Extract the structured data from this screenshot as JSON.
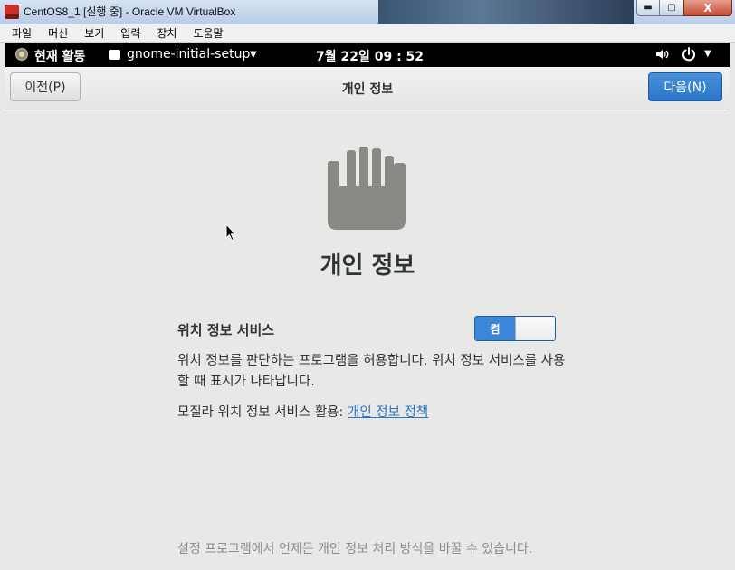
{
  "window": {
    "title": "CentOS8_1 [실행 중] - Oracle VM VirtualBox",
    "close_glyph": "X",
    "minimize_glyph": "▬",
    "maximize_glyph": "▢"
  },
  "vb_menu": [
    "파일",
    "머신",
    "보기",
    "입력",
    "장치",
    "도움말"
  ],
  "gnome_bar": {
    "activities": "현재 활동",
    "app_name": "gnome-initial-setup",
    "clock": "7월 22일  09 : 52",
    "dropdown_arrow": "▼"
  },
  "header": {
    "prev_label": "이전(P)",
    "title": "개인 정보",
    "next_label": "다음(N)",
    "next_color": "#3b86d8"
  },
  "content": {
    "icon": "hand-stop-icon",
    "heading": "개인 정보",
    "location_label": "위치 정보 서비스",
    "toggle_on_label": "켬",
    "toggle_state": "on",
    "description": "위치 정보를 판단하는 프로그램을 허용합니다. 위치 정보 서비스를 사용할 때 표시가 나타납니다.",
    "mozilla_text": "모질라 위치 정보 서비스 활용: ",
    "policy_link": "개인 정보 정책",
    "footer_note": "설정 프로그램에서 언제든 개인 정보 처리 방식을 바꿀 수 있습니다."
  },
  "colors": {
    "accent": "#3b86d8",
    "link": "#2a76c6",
    "background": "#e8e8e7",
    "topbar": "#000000"
  }
}
